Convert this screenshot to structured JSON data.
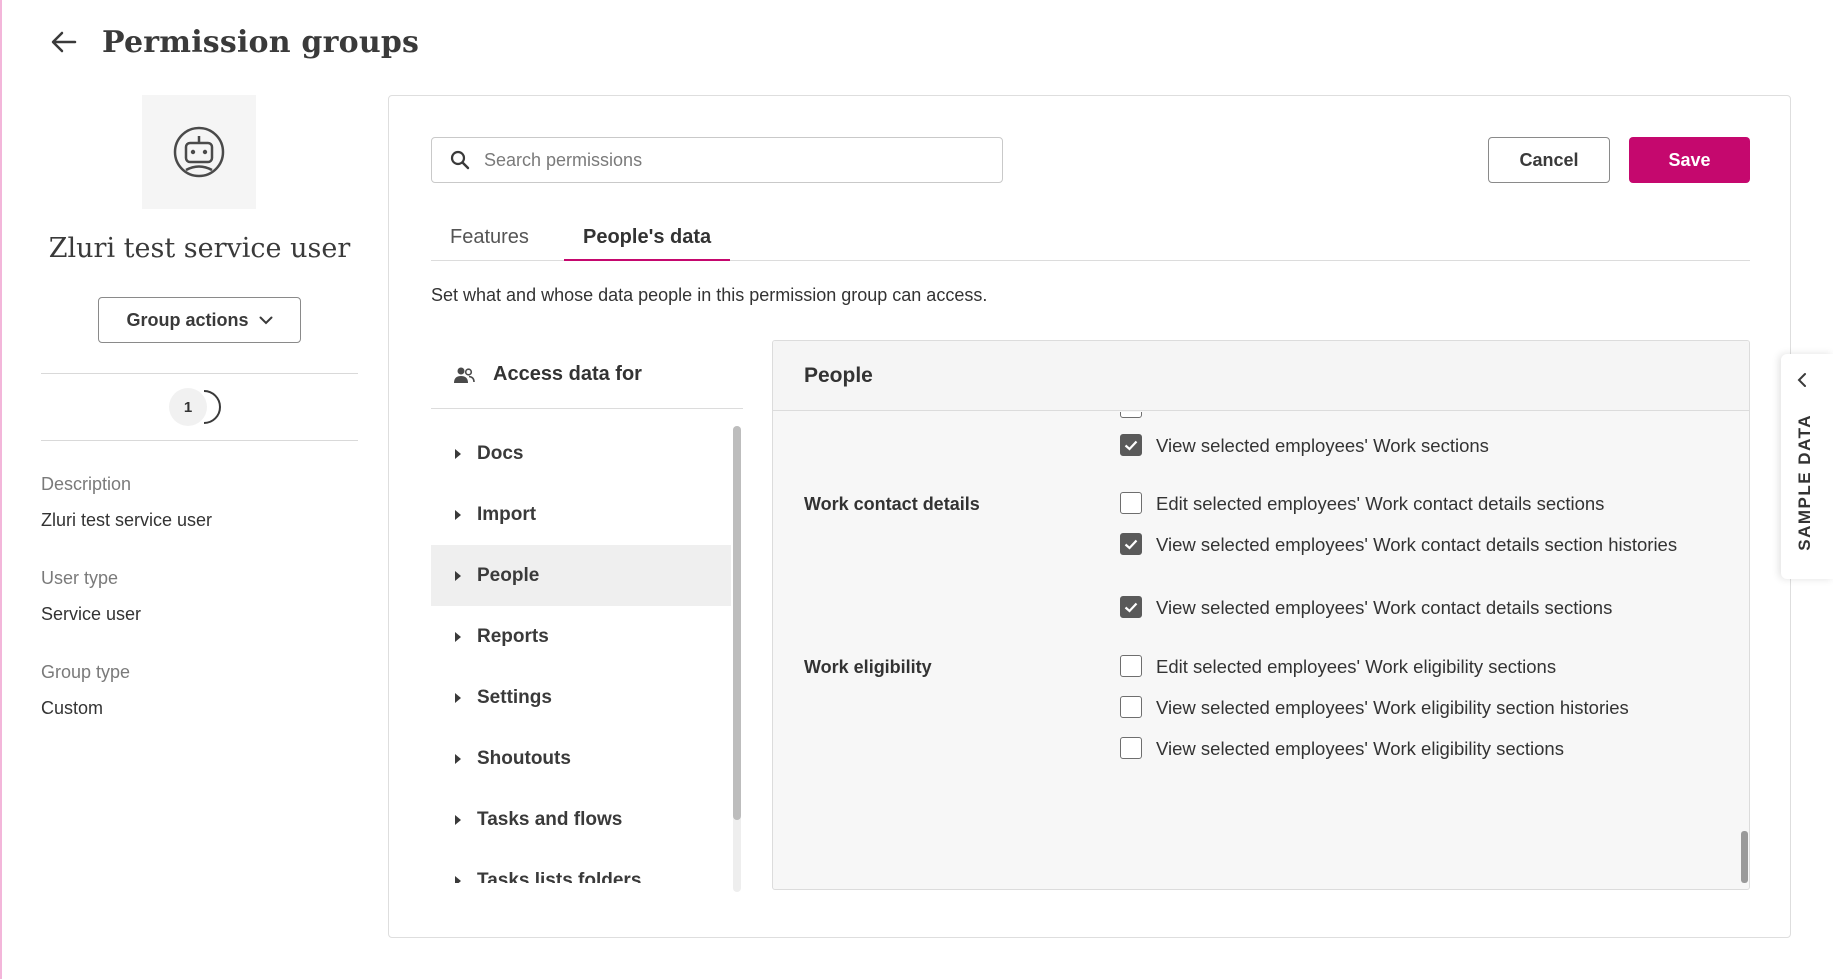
{
  "header": {
    "title": "Permission groups"
  },
  "group": {
    "name": "Zluri test service user",
    "actions_label": "Group actions",
    "member_count": "1",
    "description_label": "Description",
    "description_value": "Zluri test service user",
    "user_type_label": "User type",
    "user_type_value": "Service user",
    "group_type_label": "Group type",
    "group_type_value": "Custom"
  },
  "search": {
    "placeholder": "Search permissions",
    "value": ""
  },
  "buttons": {
    "cancel": "Cancel",
    "save": "Save"
  },
  "tabs": [
    {
      "label": "Features",
      "active": false
    },
    {
      "label": "People's data",
      "active": true
    }
  ],
  "tab_description": "Set what and whose data people in this permission group can access.",
  "access_data": {
    "title": "Access data for",
    "items": [
      {
        "label": "Docs",
        "selected": false
      },
      {
        "label": "Import",
        "selected": false
      },
      {
        "label": "People",
        "selected": true
      },
      {
        "label": "Reports",
        "selected": false
      },
      {
        "label": "Settings",
        "selected": false
      },
      {
        "label": "Shoutouts",
        "selected": false
      },
      {
        "label": "Tasks and flows",
        "selected": false
      },
      {
        "label": "Tasks lists folders",
        "selected": false
      }
    ]
  },
  "people_panel": {
    "title": "People",
    "sections": [
      {
        "label": "",
        "permissions": [
          {
            "text": "View selected employees' Work sections",
            "checked": true
          }
        ]
      },
      {
        "label": "Work contact details",
        "permissions": [
          {
            "text": "Edit selected employees' Work contact details sections",
            "checked": false
          },
          {
            "text": "View selected employees' Work contact details section histories",
            "checked": true
          },
          {
            "text": "View selected employees' Work contact details sections",
            "checked": true
          }
        ]
      },
      {
        "label": "Work eligibility",
        "permissions": [
          {
            "text": "Edit selected employees' Work eligibility sections",
            "checked": false
          },
          {
            "text": "View selected employees' Work eligibility section histories",
            "checked": false
          },
          {
            "text": "View selected employees' Work eligibility sections",
            "checked": false
          }
        ]
      }
    ]
  },
  "sample_data": {
    "label": "SAMPLE DATA"
  },
  "colors": {
    "accent": "#c5086e",
    "checkbox_checked": "#5a5a5a"
  },
  "icons": [
    "back-arrow-icon",
    "robot-icon",
    "chevron-down-icon",
    "search-icon",
    "people-icon",
    "caret-right-icon",
    "checkmark-icon",
    "chevron-left-icon"
  ]
}
